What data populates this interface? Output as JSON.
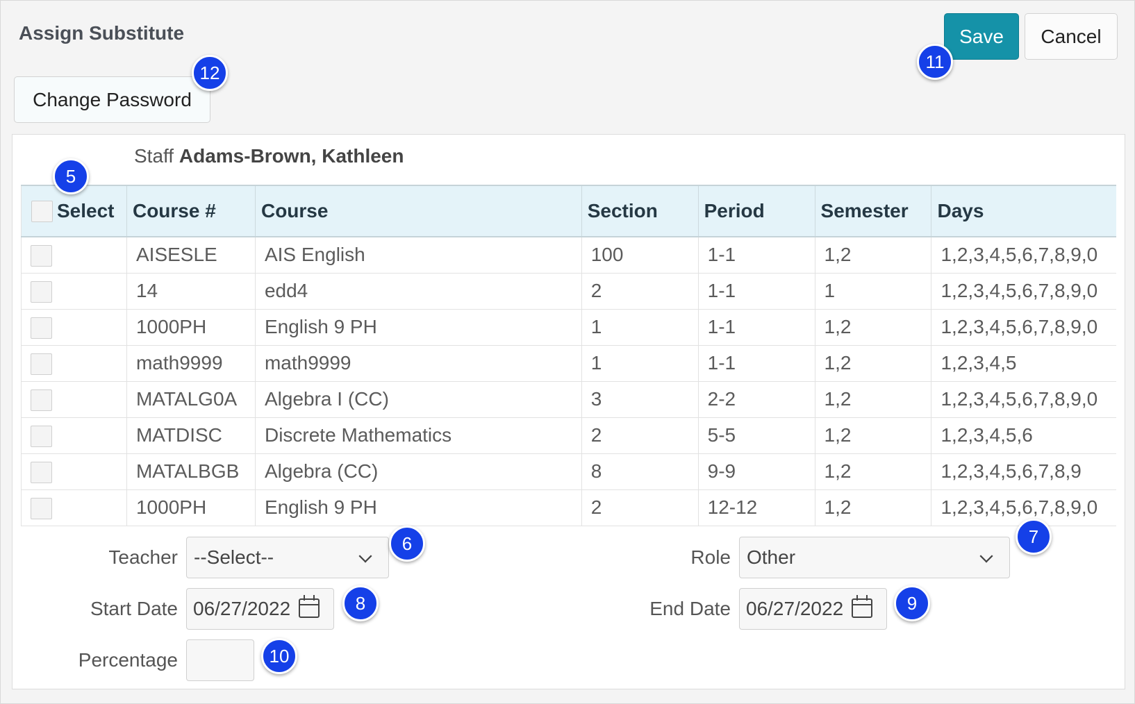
{
  "header": {
    "title": "Assign Substitute",
    "save_label": "Save",
    "cancel_label": "Cancel",
    "change_password_label": "Change Password"
  },
  "staff": {
    "prefix": "Staff",
    "name": "Adams-Brown, Kathleen"
  },
  "table": {
    "columns": [
      "Select",
      "Course #",
      "Course",
      "Section",
      "Period",
      "Semester",
      "Days"
    ],
    "rows": [
      {
        "selected": false,
        "course_num": "AISESLE",
        "course": "AIS English",
        "section": "100",
        "period": "1-1",
        "semester": "1,2",
        "days": "1,2,3,4,5,6,7,8,9,0"
      },
      {
        "selected": false,
        "course_num": "14",
        "course": "edd4",
        "section": "2",
        "period": "1-1",
        "semester": "1",
        "days": "1,2,3,4,5,6,7,8,9,0"
      },
      {
        "selected": false,
        "course_num": "1000PH",
        "course": "English 9 PH",
        "section": "1",
        "period": "1-1",
        "semester": "1,2",
        "days": "1,2,3,4,5,6,7,8,9,0"
      },
      {
        "selected": false,
        "course_num": "math9999",
        "course": "math9999",
        "section": "1",
        "period": "1-1",
        "semester": "1,2",
        "days": "1,2,3,4,5"
      },
      {
        "selected": false,
        "course_num": "MATALG0A",
        "course": "Algebra I (CC)",
        "section": "3",
        "period": "2-2",
        "semester": "1,2",
        "days": "1,2,3,4,5,6,7,8,9,0"
      },
      {
        "selected": false,
        "course_num": "MATDISC",
        "course": "Discrete Mathematics",
        "section": "2",
        "period": "5-5",
        "semester": "1,2",
        "days": "1,2,3,4,5,6"
      },
      {
        "selected": false,
        "course_num": "MATALBGB",
        "course": "Algebra (CC)",
        "section": "8",
        "period": "9-9",
        "semester": "1,2",
        "days": "1,2,3,4,5,6,7,8,9"
      },
      {
        "selected": false,
        "course_num": "1000PH",
        "course": "English 9 PH",
        "section": "2",
        "period": "12-12",
        "semester": "1,2",
        "days": "1,2,3,4,5,6,7,8,9,0"
      }
    ]
  },
  "form": {
    "teacher_label": "Teacher",
    "teacher_value": "--Select--",
    "role_label": "Role",
    "role_value": "Other",
    "start_date_label": "Start Date",
    "start_date_value": "06/27/2022",
    "end_date_label": "End Date",
    "end_date_value": "06/27/2022",
    "percentage_label": "Percentage",
    "percentage_value": ""
  },
  "badges": [
    "5",
    "6",
    "7",
    "8",
    "9",
    "10",
    "11",
    "12"
  ],
  "colors": {
    "save_bg": "#1592a8",
    "header_row_bg": "#e4f3f9",
    "badge_bg": "#1540e8"
  }
}
